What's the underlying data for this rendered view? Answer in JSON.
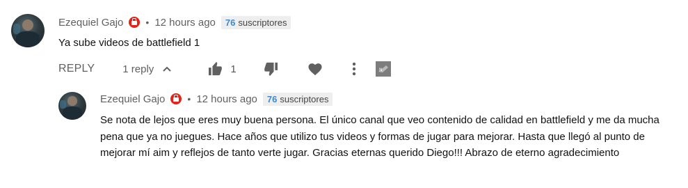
{
  "comment": {
    "author": "Ezequiel Gajo",
    "separator": "•",
    "time": "12 hours ago",
    "subscriber_count": "76",
    "subscriber_label": "suscriptores",
    "text": "Ya sube videos de battlefield 1",
    "actions": {
      "reply_label": "REPLY",
      "replies_label": "1 reply",
      "like_count": "1"
    }
  },
  "reply": {
    "author": "Ezequiel Gajo",
    "separator": "•",
    "time": "12 hours ago",
    "subscriber_count": "76",
    "subscriber_label": "suscriptores",
    "text": "Se nota de lejos que eres muy buena persona. El único canal que veo contenido de calidad en battlefield y me da mucha pena que ya no juegues. Hace años que utilizo tus videos y formas de jugar para mejorar. Hasta que llegó al punto de mejorar mí aim y reflejos de tanto verte jugar. Gracias eternas querido Diego!!! Abrazo de eterno agradecimiento"
  },
  "icons": {
    "badge": "youtube-badge-icon",
    "expand": "chevron-up-icon",
    "like": "thumbs-up-icon",
    "dislike": "thumbs-down-icon",
    "heart": "heart-icon",
    "more": "more-vert-icon",
    "extension": "extension-icon"
  },
  "colors": {
    "badge_red": "#e62117",
    "subscriber_number": "#3f8ac7",
    "meta_gray": "#606060"
  }
}
